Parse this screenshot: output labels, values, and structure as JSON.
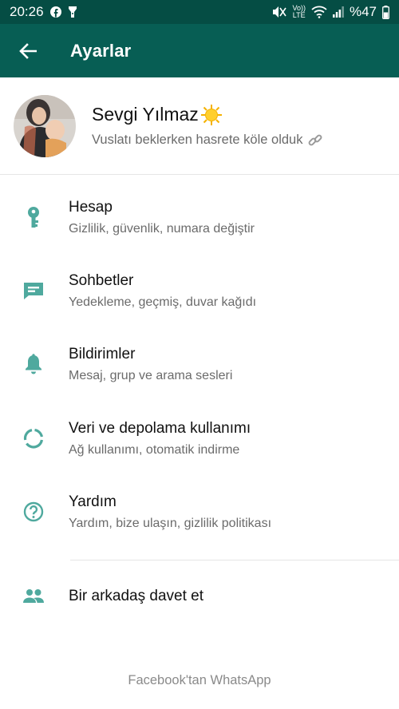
{
  "status_bar": {
    "time": "20:26",
    "battery": "%47",
    "volte_top": "Vo))",
    "volte_bottom": "LTE"
  },
  "app_bar": {
    "title": "Ayarlar"
  },
  "profile": {
    "name": "Sevgi Yılmaz",
    "status": "Vuslatı beklerken hasrete köle olduk"
  },
  "menu": [
    {
      "icon": "key-icon",
      "title": "Hesap",
      "subtitle": "Gizlilik, güvenlik, numara değiştir"
    },
    {
      "icon": "chat-icon",
      "title": "Sohbetler",
      "subtitle": "Yedekleme, geçmiş, duvar kağıdı"
    },
    {
      "icon": "bell-icon",
      "title": "Bildirimler",
      "subtitle": "Mesaj, grup ve arama sesleri"
    },
    {
      "icon": "data-usage-icon",
      "title": "Veri ve depolama kullanımı",
      "subtitle": "Ağ kullanımı, otomatik indirme"
    },
    {
      "icon": "help-icon",
      "title": "Yardım",
      "subtitle": "Yardım, bize ulaşın, gizlilik politikası"
    },
    {
      "icon": "people-icon",
      "title": "Bir arkadaş davet et"
    }
  ],
  "footer": "Facebook'tan WhatsApp",
  "colors": {
    "status_bar": "#054d44",
    "app_bar": "#075e54",
    "icon_teal": "#4fa99e"
  }
}
